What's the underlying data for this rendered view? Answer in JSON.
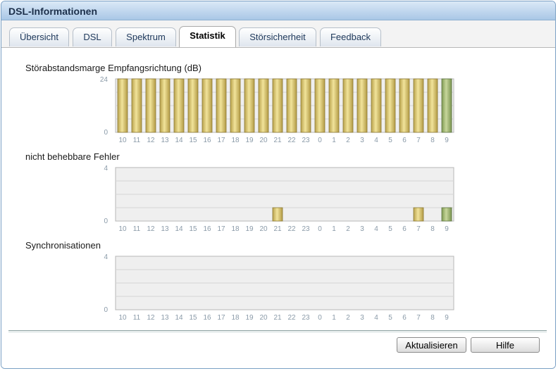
{
  "window": {
    "title": "DSL-Informationen"
  },
  "tabs": [
    {
      "label": "Übersicht",
      "active": false
    },
    {
      "label": "DSL",
      "active": false
    },
    {
      "label": "Spektrum",
      "active": false
    },
    {
      "label": "Statistik",
      "active": true
    },
    {
      "label": "Störsicherheit",
      "active": false
    },
    {
      "label": "Feedback",
      "active": false
    }
  ],
  "colors": {
    "bar_fill": "#d9c56a",
    "bar_highlight": "#a7ba73",
    "plot_bg": "#efefef",
    "grid": "#d6d6d6"
  },
  "chart_data": [
    {
      "type": "bar",
      "title": "Störabstandsmarge Empfangsrichtung (dB)",
      "categories": [
        "10",
        "11",
        "12",
        "13",
        "14",
        "15",
        "16",
        "17",
        "18",
        "19",
        "20",
        "21",
        "22",
        "23",
        "0",
        "1",
        "2",
        "3",
        "4",
        "5",
        "6",
        "7",
        "8",
        "9"
      ],
      "values": [
        24,
        24,
        24,
        24,
        24,
        24,
        24,
        24,
        24,
        24,
        24,
        24,
        24,
        24,
        24,
        24,
        24,
        24,
        24,
        24,
        24,
        24,
        24,
        24
      ],
      "ylim": [
        0,
        24
      ],
      "yticks": [
        "24",
        "0"
      ],
      "highlight_last": true
    },
    {
      "type": "bar",
      "title": "nicht behebbare Fehler",
      "categories": [
        "10",
        "11",
        "12",
        "13",
        "14",
        "15",
        "16",
        "17",
        "18",
        "19",
        "20",
        "21",
        "22",
        "23",
        "0",
        "1",
        "2",
        "3",
        "4",
        "5",
        "6",
        "7",
        "8",
        "9"
      ],
      "values": [
        0,
        0,
        0,
        0,
        0,
        0,
        0,
        0,
        0,
        0,
        0,
        1,
        0,
        0,
        0,
        0,
        0,
        0,
        0,
        0,
        0,
        1,
        0,
        1
      ],
      "ylim": [
        0,
        4
      ],
      "yticks": [
        "4",
        "0"
      ],
      "highlight_last": true
    },
    {
      "type": "bar",
      "title": "Synchronisationen",
      "categories": [
        "10",
        "11",
        "12",
        "13",
        "14",
        "15",
        "16",
        "17",
        "18",
        "19",
        "20",
        "21",
        "22",
        "23",
        "0",
        "1",
        "2",
        "3",
        "4",
        "5",
        "6",
        "7",
        "8",
        "9"
      ],
      "values": [
        0,
        0,
        0,
        0,
        0,
        0,
        0,
        0,
        0,
        0,
        0,
        0,
        0,
        0,
        0,
        0,
        0,
        0,
        0,
        0,
        0,
        0,
        0,
        0
      ],
      "ylim": [
        0,
        4
      ],
      "yticks": [
        "4",
        "0"
      ],
      "highlight_last": true
    }
  ],
  "buttons": {
    "refresh": "Aktualisieren",
    "help": "Hilfe"
  }
}
